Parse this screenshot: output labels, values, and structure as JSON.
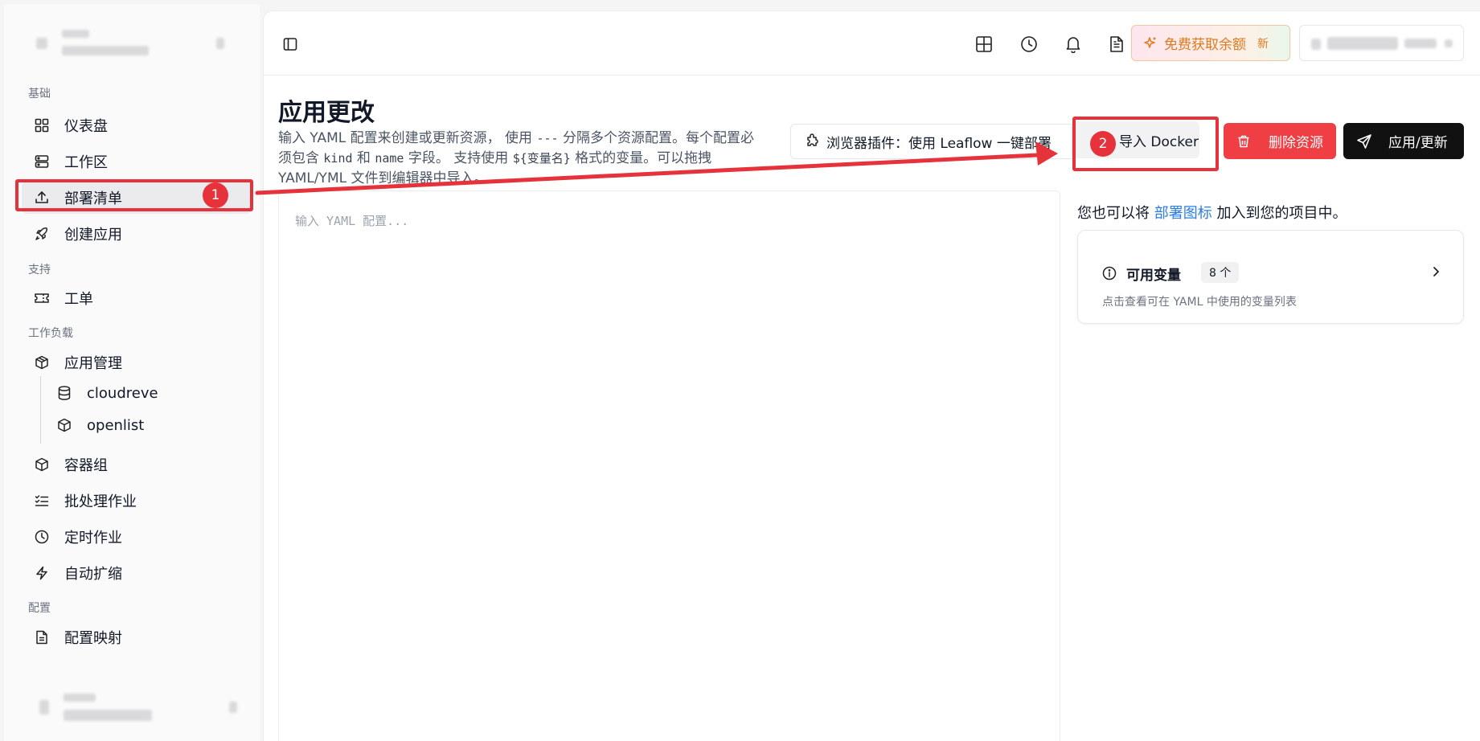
{
  "sidebar": {
    "sections": {
      "basic": "基础",
      "support": "支持",
      "workload": "工作负载",
      "config": "配置"
    },
    "items": {
      "dashboard": "仪表盘",
      "workspace": "工作区",
      "manifest": "部署清单",
      "create_app": "创建应用",
      "ticket": "工单",
      "app_mgmt": "应用管理",
      "cloudreve": "cloudreve",
      "openlist": "openlist",
      "pod_group": "容器组",
      "batch_job": "批处理作业",
      "cron_job": "定时作业",
      "autoscale": "自动扩缩",
      "config_map": "配置映射"
    }
  },
  "annotations": {
    "step1": "1",
    "step2": "2"
  },
  "topbar": {
    "promo_label": "免费获取余额",
    "promo_badge": "新"
  },
  "page": {
    "title": "应用更改",
    "desc_1": "输入 YAML 配置来创建或更新资源， 使用 ",
    "desc_sep": "---",
    "desc_2": " 分隔多个资源配置。每个配置必须包含 ",
    "desc_kind": "kind",
    "desc_3": " 和 ",
    "desc_name": "name",
    "desc_4": " 字段。 支持使用 ",
    "desc_var": "${变量名}",
    "desc_5": " 格式的变量。可以拖拽 YAML/YML 文件到编辑器中导入。"
  },
  "actions": {
    "plugin_label": "浏览器插件：使用 Leaflow 一键部署",
    "docker_label": "导入 Docker",
    "delete_label": "删除资源",
    "apply_label": "应用/更新"
  },
  "editor": {
    "placeholder": "输入 YAML 配置..."
  },
  "hint": {
    "prefix": "您也可以将 ",
    "link": "部署图标",
    "suffix": " 加入到您的项目中。"
  },
  "variables": {
    "title": "可用变量",
    "count": "8 个",
    "subtitle": "点击查看可在 YAML 中使用的变量列表"
  },
  "colors": {
    "accent_red": "#e5323b",
    "delete_red": "#ef3e44",
    "link_blue": "#2b7de9",
    "promo_orange": "#e07a1f"
  }
}
